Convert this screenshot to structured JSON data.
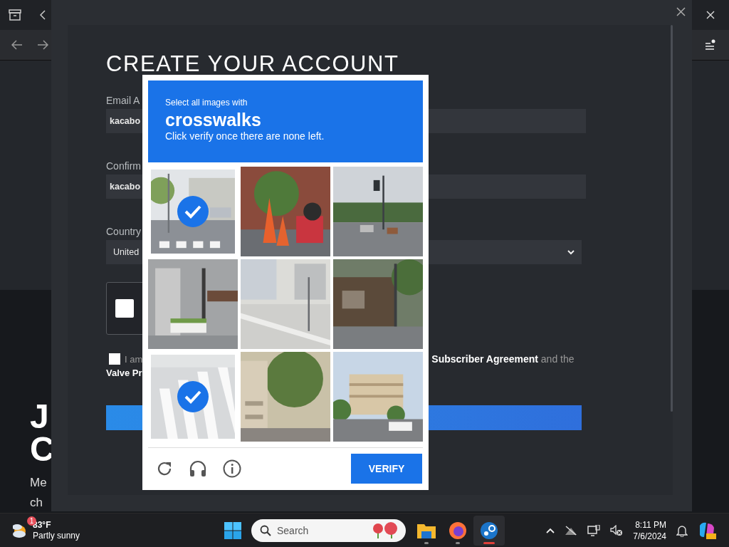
{
  "browser": {
    "hero_heading": [
      "J",
      "C"
    ],
    "hero_text": [
      "Me",
      "ch"
    ]
  },
  "dialog": {
    "title": "CREATE YOUR ACCOUNT",
    "fields": [
      {
        "label": "Email A",
        "value": "kacabo"
      },
      {
        "label": "Confirm",
        "value": "kacabo"
      }
    ],
    "country": {
      "label": "Country",
      "value": "United"
    },
    "captcha_checkbox": {
      "checked": false
    },
    "agreement": {
      "checked": false,
      "lead": "I am",
      "tail": "**Subscriber Agreement** and the",
      "second_line": "Valve Pr"
    }
  },
  "captcha": {
    "prompt": "Select all images with",
    "target": "crosswalks",
    "hint": "Click verify once there are none left.",
    "tiles": [
      {
        "selected": true,
        "faded": false
      },
      {
        "selected": false,
        "faded": false
      },
      {
        "selected": false,
        "faded": false
      },
      {
        "selected": false,
        "faded": false
      },
      {
        "selected": false,
        "faded": false
      },
      {
        "selected": false,
        "faded": false
      },
      {
        "selected": true,
        "faded": true
      },
      {
        "selected": false,
        "faded": false
      },
      {
        "selected": false,
        "faded": false
      }
    ],
    "verify_label": "VERIFY"
  },
  "taskbar": {
    "weather": {
      "badge": "1",
      "temperature": "83°F",
      "condition": "Partly sunny"
    },
    "search_placeholder": "Search",
    "apps": [
      {
        "kind": "folder",
        "selected": false
      },
      {
        "kind": "firefox",
        "selected": false
      },
      {
        "kind": "steam",
        "selected": true
      }
    ],
    "time": "8:11 PM",
    "date": "7/6/2024"
  }
}
